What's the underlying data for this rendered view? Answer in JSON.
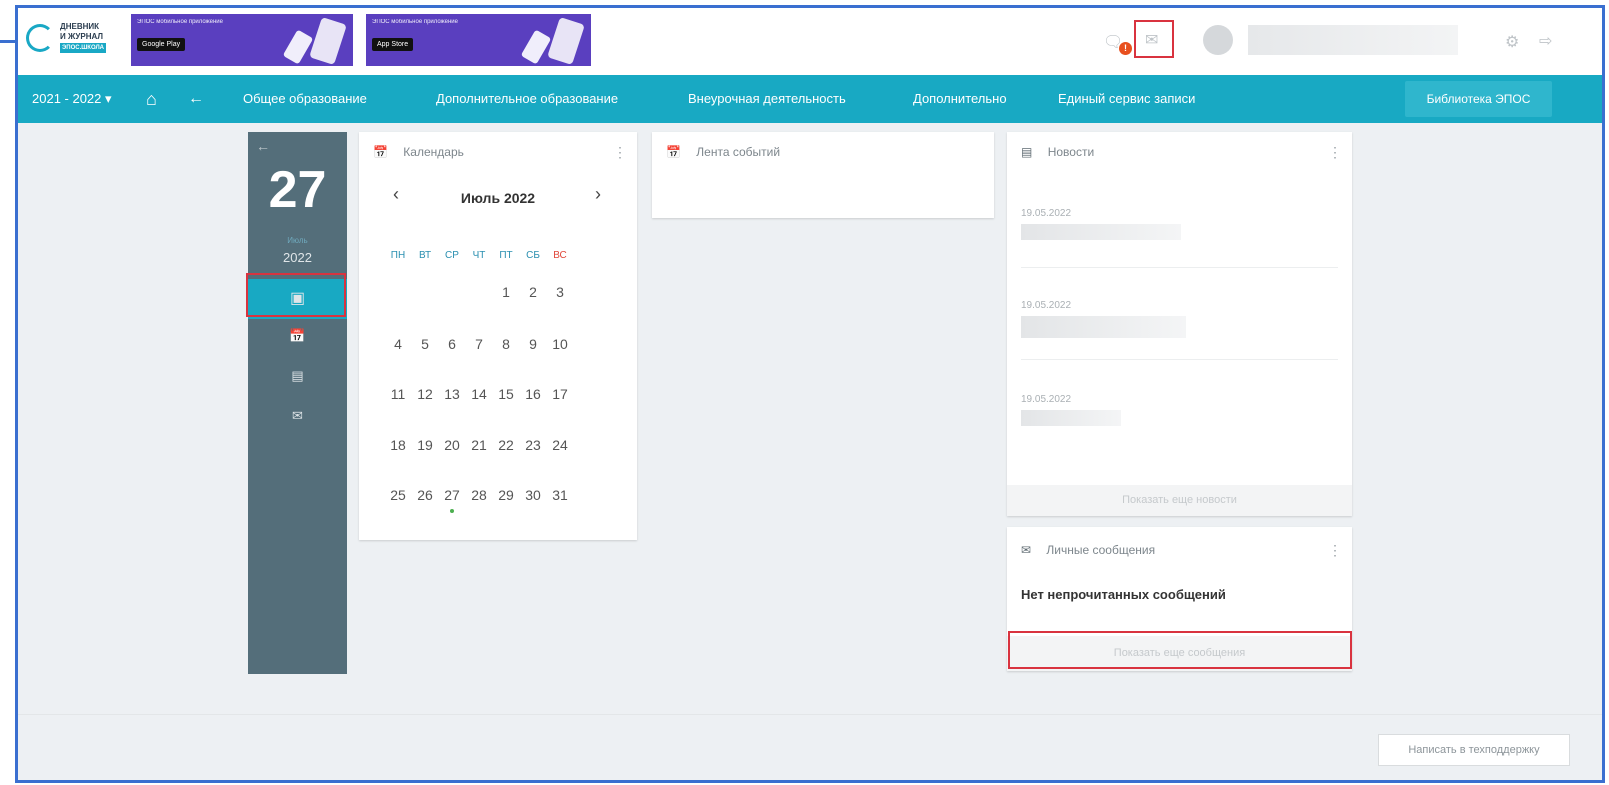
{
  "logo": {
    "line1": "ДНЕВНИК",
    "line2": "И ЖУРНАЛ",
    "badge": "ЭПОС.ШКОЛА"
  },
  "promos": [
    {
      "title": "ЭПОС мобильное приложение",
      "store": "Google Play"
    },
    {
      "title": "ЭПОС мобильное приложение",
      "store": "App Store"
    }
  ],
  "header": {
    "notification_count": "!"
  },
  "nav": {
    "year": "2021 - 2022 ▾",
    "items": [
      "Общее образование",
      "Дополнительное образование",
      "Внеурочная деятельность",
      "Дополнительно",
      "Единый сервис записи"
    ],
    "library": "Библиотека ЭПОС"
  },
  "sidebar": {
    "day": "27",
    "month": "Июль",
    "year": "2022"
  },
  "calendar": {
    "title": "Календарь",
    "month_label": "Июль 2022",
    "weekdays": [
      "ПН",
      "ВТ",
      "СР",
      "ЧТ",
      "ПТ",
      "СБ",
      "ВС"
    ],
    "weeks": [
      [
        "",
        "",
        "",
        "",
        "1",
        "2",
        "3"
      ],
      [
        "4",
        "5",
        "6",
        "7",
        "8",
        "9",
        "10"
      ],
      [
        "11",
        "12",
        "13",
        "14",
        "15",
        "16",
        "17"
      ],
      [
        "18",
        "19",
        "20",
        "21",
        "22",
        "23",
        "24"
      ],
      [
        "25",
        "26",
        "27",
        "28",
        "29",
        "30",
        "31"
      ]
    ]
  },
  "events": {
    "title": "Лента событий"
  },
  "news": {
    "title": "Новости",
    "items": [
      {
        "date": "19.05.2022"
      },
      {
        "date": "19.05.2022"
      },
      {
        "date": "19.05.2022"
      }
    ],
    "more": "Показать еще новости"
  },
  "messages": {
    "title": "Личные сообщения",
    "empty": "Нет непрочитанных сообщений",
    "more": "Показать еще сообщения"
  },
  "support": "Написать в техподдержку",
  "colors": {
    "accent": "#18a9c3",
    "sidebar": "#546e7a",
    "highlight": "#d9333f",
    "sunday": "#e0473a"
  }
}
